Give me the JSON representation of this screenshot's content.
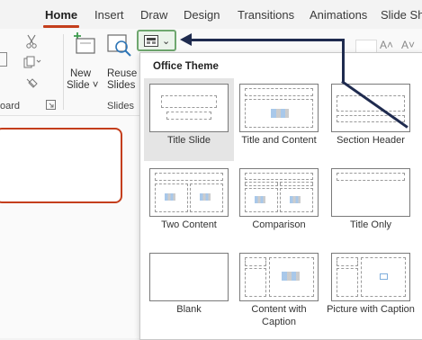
{
  "ribbon_tabs": [
    {
      "label": "Home",
      "active": true
    },
    {
      "label": "Insert",
      "active": false
    },
    {
      "label": "Draw",
      "active": false
    },
    {
      "label": "Design",
      "active": false
    },
    {
      "label": "Transitions",
      "active": false
    },
    {
      "label": "Animations",
      "active": false
    },
    {
      "label": "Slide Show",
      "active": false
    }
  ],
  "ribbon": {
    "clipboard_group_label": "oard",
    "slides_group_label": "Slides",
    "new_slide_label_line1": "New",
    "new_slide_label_line2": "Slide ˅",
    "reuse_slides_label_line1": "Reuse",
    "reuse_slides_label_line2": "Slides"
  },
  "layout_dropdown": {
    "title": "Office Theme",
    "layouts": [
      {
        "label": "Title Slide",
        "selected": true
      },
      {
        "label": "Title and Content",
        "selected": false
      },
      {
        "label": "Section Header",
        "selected": false
      },
      {
        "label": "Two Content",
        "selected": false
      },
      {
        "label": "Comparison",
        "selected": false
      },
      {
        "label": "Title Only",
        "selected": false
      },
      {
        "label": "Blank",
        "selected": false
      },
      {
        "label": "Content with Caption",
        "selected": false
      },
      {
        "label": "Picture with Caption",
        "selected": false
      }
    ]
  },
  "colors": {
    "accent": "#c43e1c",
    "highlight": "#6fa76f",
    "arrow": "#1f2b4f"
  },
  "icons": [
    "cut-icon",
    "paste-icon",
    "format-painter-icon",
    "new-slide-icon",
    "reuse-slides-icon",
    "layout-icon",
    "chevron-down-icon",
    "dialog-launcher-icon"
  ]
}
